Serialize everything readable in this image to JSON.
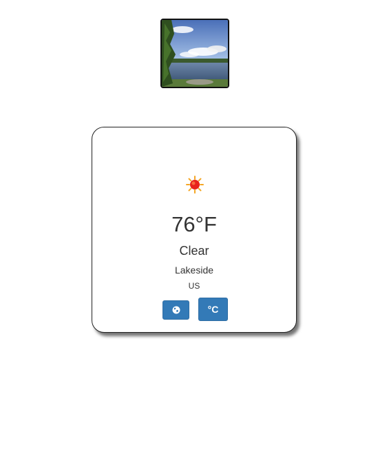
{
  "photo": {
    "alt": "lake-landscape-photo"
  },
  "weather": {
    "icon": "sun-icon",
    "temperature": "76°F",
    "condition": "Clear",
    "city": "Lakeside",
    "country": "US"
  },
  "buttons": {
    "globe_icon": "globe-icon",
    "unit_label": "°C"
  },
  "colors": {
    "button_bg": "#337ab7",
    "text": "#333333",
    "sun_core": "#e8231c",
    "sun_rays": "#f5a623"
  }
}
